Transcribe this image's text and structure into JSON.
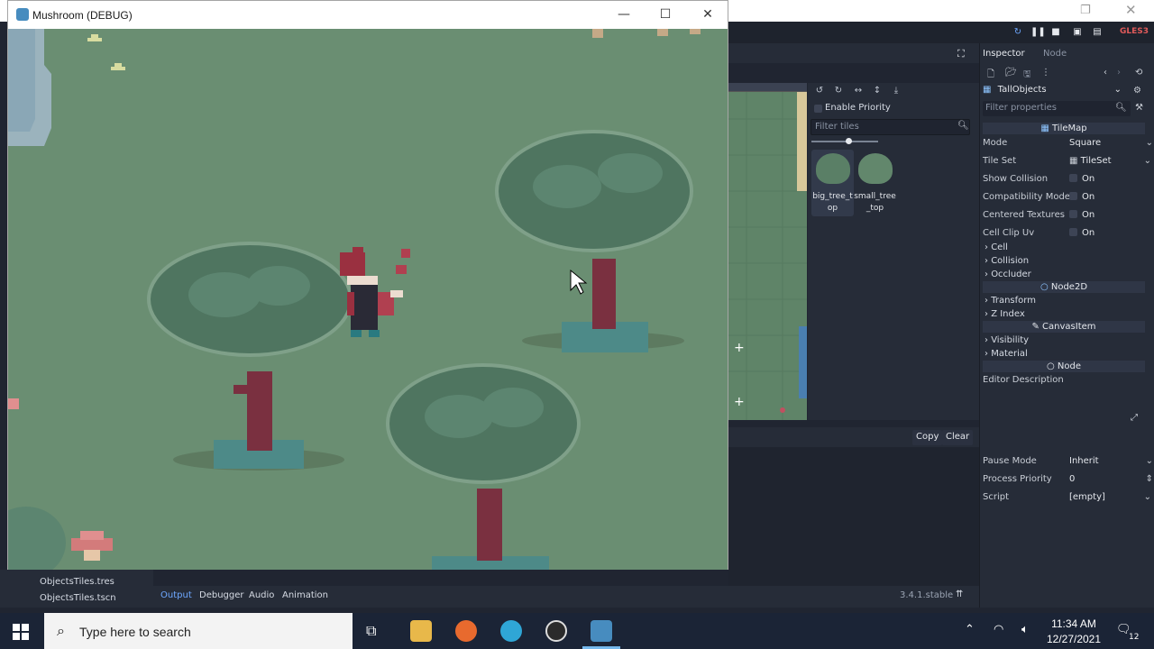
{
  "game_window": {
    "title": "Mushroom (DEBUG)",
    "minimize_icon": "minimize-icon",
    "maximize_icon": "maximize-icon",
    "close_icon": "close-icon"
  },
  "editor": {
    "renderer_label": "GLES3",
    "tile_panel": {
      "enable_priority_label": "Enable Priority",
      "filter_placeholder": "Filter tiles",
      "tiles": [
        {
          "name": "big_tree_top"
        },
        {
          "name": "small_tree_top"
        }
      ]
    },
    "output": {
      "copy_label": "Copy",
      "clear_label": "Clear"
    },
    "bottom_tabs": [
      "Output",
      "Debugger",
      "Audio",
      "Animation"
    ],
    "version": "3.4.1.stable",
    "filesystem": {
      "items": [
        "ObjectsTiles.tres",
        "ObjectsTiles.tscn"
      ]
    }
  },
  "inspector": {
    "tabs": [
      "Inspector",
      "Node"
    ],
    "node_name": "TallObjects",
    "filter_placeholder": "Filter properties",
    "class_tilemap": "TileMap",
    "props": {
      "mode_key": "Mode",
      "mode_value": "Square",
      "tileset_key": "Tile Set",
      "tileset_value": "TileSet",
      "show_collision_key": "Show Collision",
      "show_collision_value": "On",
      "compat_key": "Compatibility Mode",
      "compat_value": "On",
      "centered_key": "Centered Textures",
      "centered_value": "On",
      "clip_key": "Cell Clip Uv",
      "clip_value": "On"
    },
    "tilemap_groups": [
      "Cell",
      "Collision",
      "Occluder"
    ],
    "class_node2d": "Node2D",
    "node2d_groups": [
      "Transform",
      "Z Index"
    ],
    "class_canvasitem": "CanvasItem",
    "canvasitem_groups": [
      "Visibility",
      "Material"
    ],
    "class_node": "Node",
    "editor_description": "Editor Description",
    "node_props": {
      "pause_key": "Pause Mode",
      "pause_value": "Inherit",
      "priority_key": "Process Priority",
      "priority_value": "0",
      "script_key": "Script",
      "script_value": "[empty]"
    }
  },
  "taskbar": {
    "search_placeholder": "Type here to search",
    "time": "11:34 AM",
    "date": "12/27/2021",
    "notification_count": "12"
  },
  "colors": {
    "godot_blue": "#478cbf",
    "grass": "#6a8e72",
    "tree_leaf": "#4f7560",
    "trunk": "#7a3040"
  }
}
